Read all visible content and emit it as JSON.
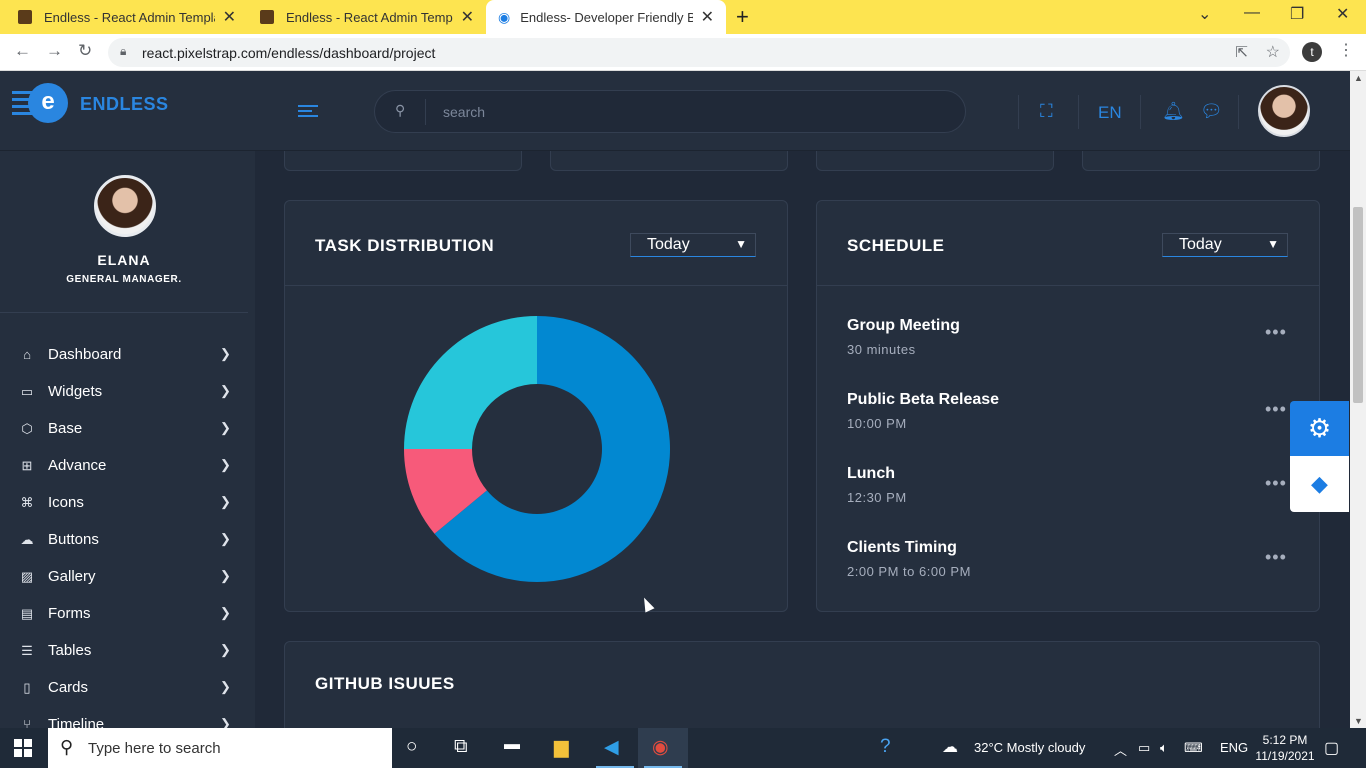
{
  "browser": {
    "tabs": [
      {
        "title": "Endless - React Admin Template"
      },
      {
        "title": "Endless - React Admin Template"
      },
      {
        "title": "Endless- Developer Friendly Best"
      }
    ],
    "url": "react.pixelstrap.com/endless/dashboard/project",
    "profile_initial": "t"
  },
  "header": {
    "brand": "ENDLESS",
    "search_placeholder": "search",
    "language": "EN"
  },
  "sidebar": {
    "user_name": "ELANA",
    "user_role": "GENERAL MANAGER.",
    "items": [
      {
        "label": "Dashboard"
      },
      {
        "label": "Widgets"
      },
      {
        "label": "Base"
      },
      {
        "label": "Advance"
      },
      {
        "label": "Icons"
      },
      {
        "label": "Buttons"
      },
      {
        "label": "Gallery"
      },
      {
        "label": "Forms"
      },
      {
        "label": "Tables"
      },
      {
        "label": "Cards"
      },
      {
        "label": "Timeline"
      }
    ]
  },
  "task_distribution": {
    "title": "TASK DISTRIBUTION",
    "filter": "Today"
  },
  "chart_data": {
    "type": "pie",
    "donut": true,
    "slices": [
      {
        "value": 64,
        "color": "#0288d1"
      },
      {
        "value": 11,
        "color": "#f75a7a"
      },
      {
        "value": 25,
        "color": "#26c6da"
      }
    ]
  },
  "schedule": {
    "title": "SCHEDULE",
    "filter": "Today",
    "items": [
      {
        "title": "Group Meeting",
        "time": "30 minutes"
      },
      {
        "title": "Public Beta Release",
        "time": "10:00 PM"
      },
      {
        "title": "Lunch",
        "time": "12:30 PM"
      },
      {
        "title": "Clients Timing",
        "time": "2:00 PM to 6:00 PM"
      }
    ]
  },
  "github": {
    "title": "GITHUB ISUUES"
  },
  "taskbar": {
    "search_placeholder": "Type here to search",
    "weather": "32°C  Mostly cloudy",
    "language": "ENG",
    "time": "5:12 PM",
    "date": "11/19/2021"
  },
  "colors": {
    "accent": "#2a86e0",
    "card_bg": "#252f3e",
    "page_bg": "#202938"
  }
}
